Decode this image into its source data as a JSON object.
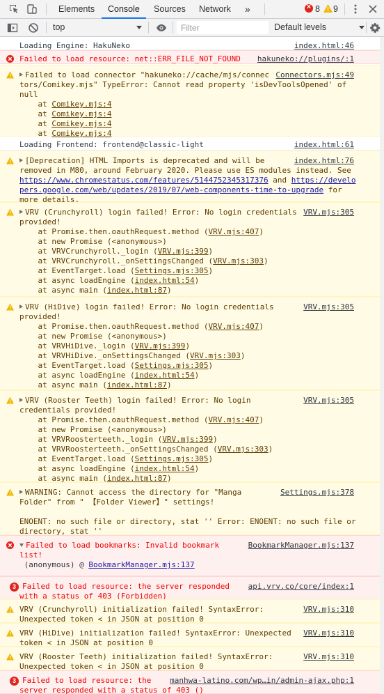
{
  "tabs": [
    "Elements",
    "Console",
    "Sources",
    "Network"
  ],
  "tabs_more": "»",
  "badges": {
    "errors": "8",
    "warnings": "9"
  },
  "toolbar": {
    "context": "top",
    "filter_placeholder": "Filter",
    "levels": "Default levels"
  },
  "colors": {
    "error": "#e0241b",
    "warning": "#f2b600",
    "accent": "#1a73e8"
  },
  "messages": [
    {
      "type": "info",
      "lines": [
        "Loading Engine: HakuNeko"
      ],
      "source": "index.html:46"
    },
    {
      "type": "err",
      "lines": [
        "Failed to load resource: net::ERR_FILE_NOT_FOUND"
      ],
      "source": "hakuneko://plugins/:1"
    },
    {
      "type": "warn",
      "lines": [
        "Failed to load connector \"hakuneko://cache/mjs/connec",
        "tors/Comikey.mjs\" TypeError: Cannot read property 'isDevToolsOpened' of",
        "null"
      ],
      "source": "Connectors.mjs:49",
      "stack": [
        "Comikey.mjs:4",
        "Comikey.mjs:4",
        "Comikey.mjs:4",
        "Comikey.mjs:4"
      ]
    },
    {
      "type": "info",
      "lines": [
        "Loading Frontend: frontend@classic-light"
      ],
      "source": "index.html:61"
    },
    {
      "type": "warn",
      "lines": [
        "[Deprecation] HTML Imports is deprecated and will be",
        "removed in M80, around February 2020. Please use ES modules instead. See",
        "https://www.chromestatus.com/features/5144752345317376 and https://develo",
        "pers.google.com/web/updates/2019/07/web-components-time-to-upgrade for",
        "more details."
      ],
      "source": "index.html:76"
    },
    {
      "type": "warn",
      "lines": [
        "VRV (Crunchyroll) login failed! Error: No login credentials",
        "provided!",
        "    at Promise.then.oauthRequest.method (VRV.mjs:407)",
        "    at new Promise (<anonymous>)",
        "    at VRVCrunchyroll._login (VRV.mjs:399)",
        "    at VRVCrunchyroll._onSettingsChanged (VRV.mjs:303)",
        "    at EventTarget.load (Settings.mjs:305)",
        "    at async loadEngine (index.html:54)",
        "    at async main (index.html:87)"
      ],
      "source": "VRV.mjs:305"
    },
    {
      "type": "warn",
      "lines": [
        "VRV (HiDive) login failed! Error: No login credentials",
        "provided!",
        "    at Promise.then.oauthRequest.method (VRV.mjs:407)",
        "    at new Promise (<anonymous>)",
        "    at VRVHiDive._login (VRV.mjs:399)",
        "    at VRVHiDive._onSettingsChanged (VRV.mjs:303)",
        "    at EventTarget.load (Settings.mjs:305)",
        "    at async loadEngine (index.html:54)",
        "    at async main (index.html:87)"
      ],
      "source": "VRV.mjs:305"
    },
    {
      "type": "warn",
      "lines": [
        "VRV (Rooster Teeth) login failed! Error: No login",
        "credentials provided!",
        "    at Promise.then.oauthRequest.method (VRV.mjs:407)",
        "    at new Promise (<anonymous>)",
        "    at VRVRoosterteeth._login (VRV.mjs:399)",
        "    at VRVRoosterteeth._onSettingsChanged (VRV.mjs:303)",
        "    at EventTarget.load (Settings.mjs:305)",
        "    at async loadEngine (index.html:54)",
        "    at async main (index.html:87)"
      ],
      "source": "VRV.mjs:305"
    },
    {
      "type": "warn",
      "lines": [
        "WARNING: Cannot access the directory for \"Manga",
        "Folder\" from \" 【Folder Viewer】\" settings!",
        "",
        "ENOENT: no such file or directory, stat '' Error: ENOENT: no such file or",
        "directory, stat ''"
      ],
      "source": "Settings.mjs:378"
    },
    {
      "type": "err",
      "lines": [
        "Failed to load bookmarks: Invalid bookmark",
        "list!",
        " (anonymous) @ BookmarkManager.mjs:137"
      ],
      "source": "BookmarkManager.mjs:137"
    },
    {
      "type": "err",
      "lines": [
        "Failed to load resource: the server responded",
        "with a status of 403 (Forbidden)"
      ],
      "source": "api.vrv.co/core/index:1",
      "count": "3"
    },
    {
      "type": "warn",
      "lines": [
        "VRV (Crunchyroll) initialization failed! SyntaxError:",
        "Unexpected token < in JSON at position 0"
      ],
      "source": "VRV.mjs:310"
    },
    {
      "type": "warn",
      "lines": [
        "VRV (HiDive) initialization failed! SyntaxError: Unexpected",
        "token < in JSON at position 0"
      ],
      "source": "VRV.mjs:310"
    },
    {
      "type": "warn",
      "lines": [
        "VRV (Rooster Teeth) initialization failed! SyntaxError:",
        "Unexpected token < in JSON at position 0"
      ],
      "source": "VRV.mjs:310"
    },
    {
      "type": "err",
      "lines": [
        "Failed to load resource: the",
        "server responded with a status of 403 ()"
      ],
      "source": "manhwa-latino.com/wp…in/admin-ajax.php:1",
      "count": "3"
    }
  ]
}
